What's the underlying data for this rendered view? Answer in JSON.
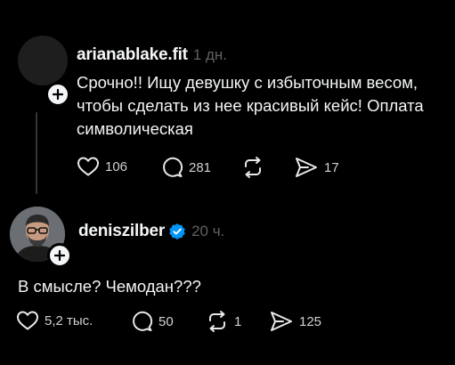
{
  "posts": [
    {
      "username": "arianablake.fit",
      "time": "1 дн.",
      "text_lines": [
        "Срочно!! Ищу девушку с избыточным весом,",
        "чтобы сделать из нее красивый кейс! Оплата",
        "символическая"
      ],
      "likes": "106",
      "comments": "281",
      "reposts": "",
      "shares": "17"
    },
    {
      "username": "deniszilber",
      "verified": true,
      "time": "20 ч.",
      "text_lines": [
        "В смысле? Чемодан???"
      ],
      "likes": "5,2 тыс.",
      "comments": "50",
      "reposts": "1",
      "shares": "125"
    }
  ],
  "icons": {
    "like": "heart-icon",
    "comment": "comment-icon",
    "repost": "repost-icon",
    "share": "send-icon",
    "follow": "plus-icon",
    "verified": "verified-badge-icon"
  },
  "colors": {
    "background": "#000000",
    "text": "#f3f5f7",
    "secondary": "#616161",
    "verified": "#0095f6"
  }
}
